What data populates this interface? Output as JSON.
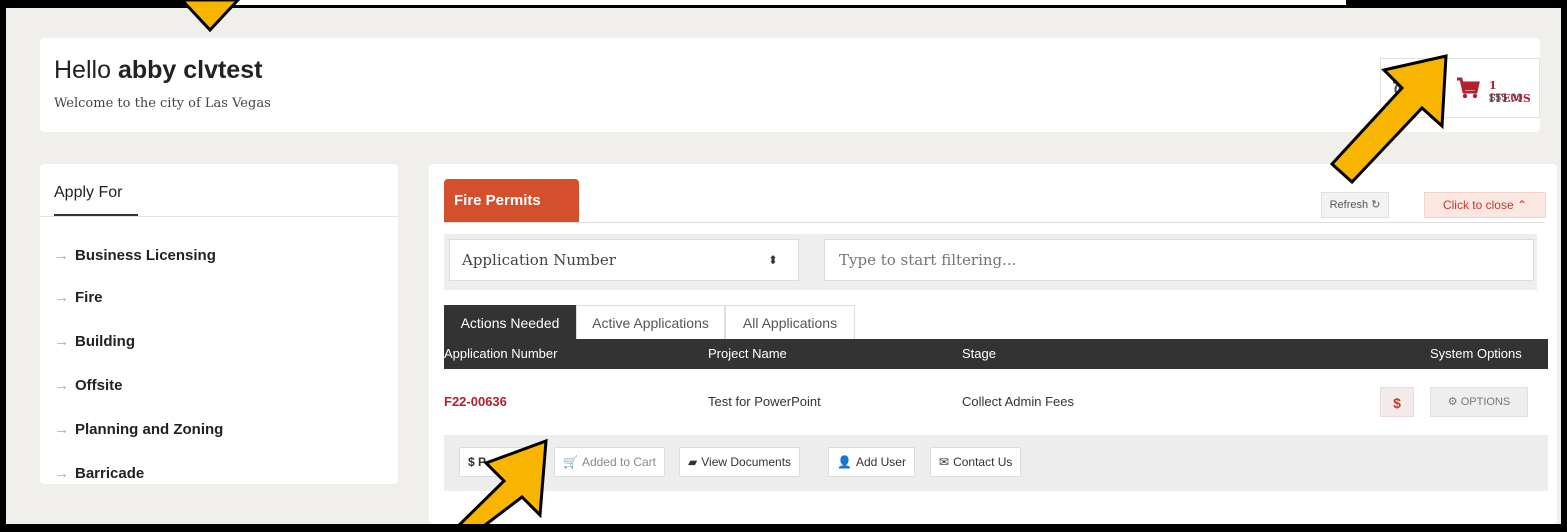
{
  "header": {
    "greeting_prefix": "Hello",
    "user_name": "abby clvtest",
    "welcome": "Welcome to the city of Las Vegas",
    "cart": {
      "items": "1 ITEMS",
      "total": "$55.00"
    }
  },
  "sidebar": {
    "title": "Apply For",
    "items": [
      {
        "label": "Business Licensing"
      },
      {
        "label": "Fire"
      },
      {
        "label": "Building"
      },
      {
        "label": "Offsite"
      },
      {
        "label": "Planning and Zoning"
      },
      {
        "label": "Barricade"
      }
    ]
  },
  "panel": {
    "tab_title": "Fire Permits",
    "refresh_label": "Refresh",
    "close_label": "Click to close",
    "filter_select_value": "Application Number",
    "filter_placeholder": "Type to start filtering..."
  },
  "tabs": [
    {
      "label": "Actions Needed"
    },
    {
      "label": "Active Applications"
    },
    {
      "label": "All Applications"
    }
  ],
  "table": {
    "columns": [
      "Application Number",
      "Project Name",
      "Stage",
      "System Options"
    ],
    "row": {
      "app_number": "F22-00636",
      "project_name": "Test for PowerPoint",
      "stage": "Collect Admin Fees",
      "pay_symbol": "$",
      "options_label": "OPTIONS"
    }
  },
  "actions": {
    "pay_label": "$ P",
    "added_to_cart": "Added to Cart",
    "view_documents": "View Documents",
    "add_user": "Add User",
    "contact_us": "Contact Us"
  },
  "colors": {
    "accent": "#d4502c",
    "brand_red": "#b21f2d",
    "arrow": "#f7b500"
  },
  "icons": [
    "cart-icon",
    "refresh-icon",
    "chevron-up-icon",
    "right-arrow-icon",
    "folder-icon",
    "user-plus-icon",
    "envelope-icon",
    "gears-icon",
    "callout-arrow"
  ]
}
